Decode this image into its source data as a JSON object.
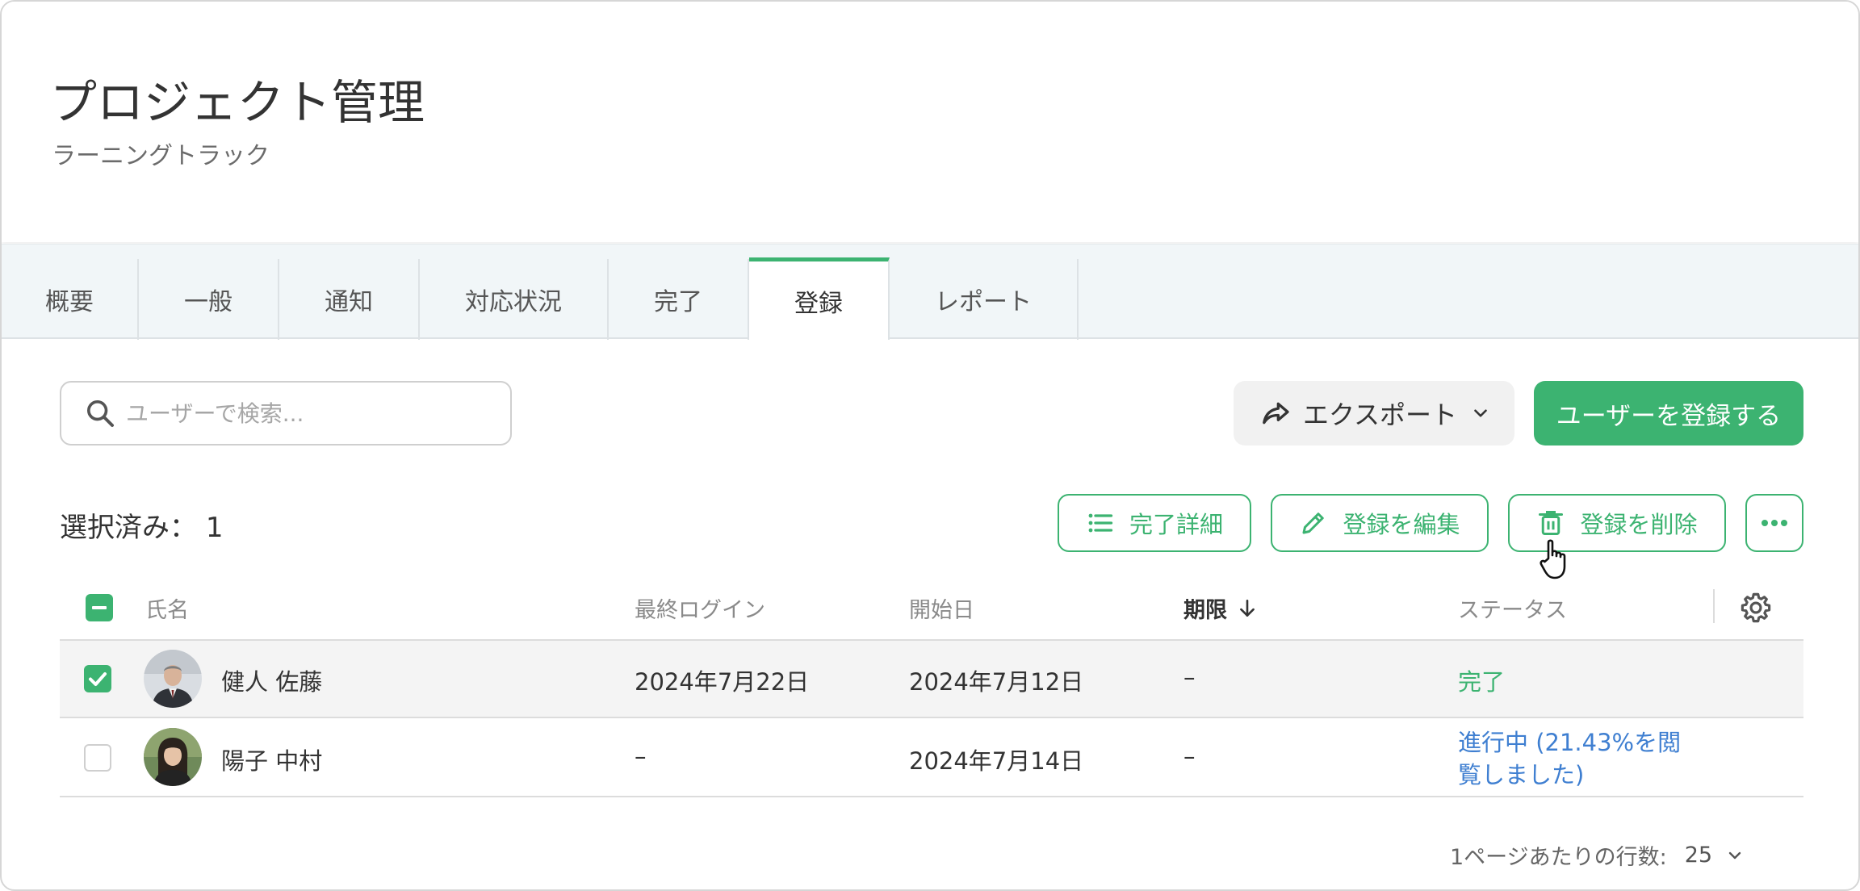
{
  "header": {
    "title": "プロジェクト管理",
    "subtitle": "ラーニングトラック"
  },
  "tabs": [
    {
      "label": "概要",
      "active": false
    },
    {
      "label": "一般",
      "active": false
    },
    {
      "label": "通知",
      "active": false
    },
    {
      "label": "対応状況",
      "active": false
    },
    {
      "label": "完了",
      "active": false
    },
    {
      "label": "登録",
      "active": true
    },
    {
      "label": "レポート",
      "active": false
    }
  ],
  "toolbar": {
    "search_placeholder": "ユーザーで検索...",
    "export_label": "エクスポート",
    "register_label": "ユーザーを登録する"
  },
  "selection": {
    "label": "選択済み：",
    "count": "1"
  },
  "actions": {
    "completion_details": "完了詳細",
    "edit_enrollment": "登録を編集",
    "delete_enrollment": "登録を削除"
  },
  "table": {
    "columns": {
      "name": "氏名",
      "last_login": "最終ログイン",
      "start_date": "開始日",
      "deadline": "期限",
      "status": "ステータス"
    },
    "rows": [
      {
        "name": "健人 佐藤",
        "last_login": "2024年7月22日",
        "start_date": "2024年7月12日",
        "deadline": "–",
        "status": "完了",
        "checked": true
      },
      {
        "name": "陽子 中村",
        "last_login": "–",
        "start_date": "2024年7月14日",
        "deadline": "–",
        "status_line1": "進行中 (21.43%を閲",
        "status_line2": "覧しました)",
        "checked": false
      }
    ]
  },
  "pagination": {
    "rows_per_page_label": "1ページあたりの行数:",
    "rows_per_page_value": "25"
  },
  "colors": {
    "accent": "#3cb371",
    "link": "#3f7fd1"
  }
}
